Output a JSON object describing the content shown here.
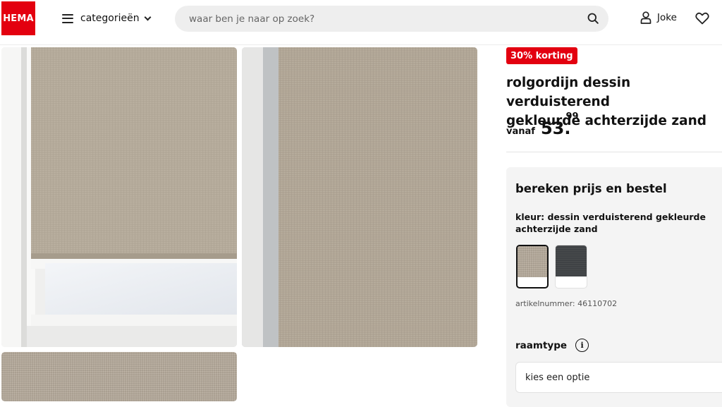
{
  "header": {
    "logo_text": "HEMA",
    "categories_label": "categorieën",
    "search_placeholder": "waar ben je naar op zoek?",
    "user_name": "Joke",
    "brand_color": "#e3000f"
  },
  "gallery": {
    "images": [
      {
        "name": "roller-blind-in-window"
      },
      {
        "name": "roller-blind-fabric-closeup"
      },
      {
        "name": "roller-blind-fabric-texture"
      }
    ]
  },
  "product": {
    "discount_badge": "30% korting",
    "title": "rolgordijn dessin verduisterend\ngekleurde achterzijde zand",
    "price_prefix": "vanaf",
    "price_main": "53.",
    "price_cents": "99"
  },
  "configurator": {
    "heading": "bereken prijs en bestel",
    "color_label": "kleur: dessin verduisterend gekleurde achterzijde zand",
    "swatches": [
      {
        "name": "zand",
        "selected": true,
        "color": "#b5aa9b"
      },
      {
        "name": "antraciet",
        "selected": false,
        "color": "#3f4245"
      }
    ],
    "article_number": "artikelnummer: 46110702",
    "window_type_label": "raamtype",
    "window_type_placeholder": "kies een optie"
  },
  "icons": [
    "hamburger-icon",
    "chevron-down-icon",
    "search-icon",
    "user-icon",
    "heart-icon",
    "info-icon"
  ]
}
